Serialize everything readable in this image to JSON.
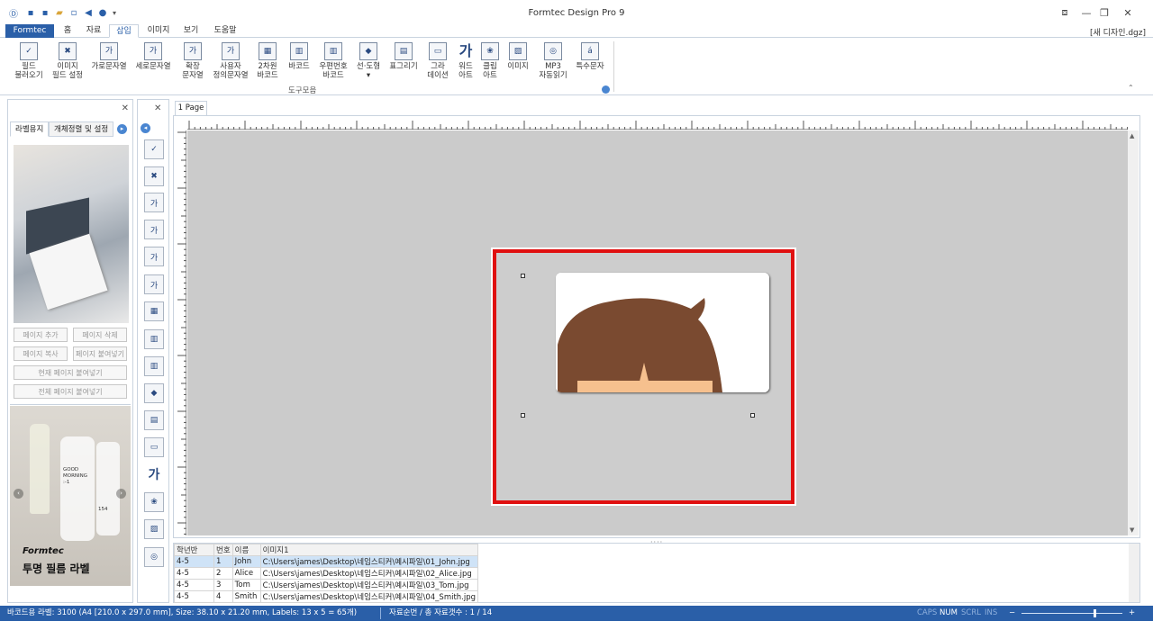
{
  "app": {
    "title": "Formtec Design Pro 9",
    "document": "[새 디자인.dgz]"
  },
  "ribbon_tabs": [
    "Formtec",
    "홈",
    "자료",
    "삽입",
    "이미지",
    "보기",
    "도움말"
  ],
  "ribbon_buttons": [
    {
      "line1": "필드",
      "line2": "불러오기",
      "glyph": "✓"
    },
    {
      "line1": "이미지",
      "line2": "필드 설정",
      "glyph": "✖"
    },
    {
      "line1": "가로문자열",
      "line2": "",
      "glyph": "가"
    },
    {
      "line1": "세로문자열",
      "line2": "",
      "glyph": "가"
    },
    {
      "line1": "확장",
      "line2": "문자열",
      "glyph": "가"
    },
    {
      "line1": "사용자",
      "line2": "정의문자열",
      "glyph": "가"
    },
    {
      "line1": "2차원",
      "line2": "바코드",
      "glyph": "▦"
    },
    {
      "line1": "바코드",
      "line2": "",
      "glyph": "▥"
    },
    {
      "line1": "우편번호",
      "line2": "바코드",
      "glyph": "▥"
    },
    {
      "line1": "선·도형",
      "line2": "▾",
      "glyph": "◆"
    },
    {
      "line1": "표그리기",
      "line2": "",
      "glyph": "▤"
    },
    {
      "line1": "그라",
      "line2": "데이션",
      "glyph": "▭"
    },
    {
      "line1": "워드",
      "line2": "아트",
      "glyph": "가"
    },
    {
      "line1": "클립",
      "line2": "아트",
      "glyph": "❀"
    },
    {
      "line1": "이미지",
      "line2": "",
      "glyph": "▨"
    },
    {
      "line1": "MP3",
      "line2": "자동읽기",
      "glyph": "◎"
    },
    {
      "line1": "특수문자",
      "line2": "",
      "glyph": "á"
    }
  ],
  "ribbon_group": "도구모음",
  "left_panel": {
    "tabs": [
      "라벨용지",
      "개체정렬 및 설정"
    ],
    "buttons": [
      "페이지 추가",
      "페이지 삭제",
      "페이지 복사",
      "페이지 붙여넣기",
      "현재 페이지 붙여넣기",
      "전체 페이지 붙여넣기"
    ],
    "ad_bottle_text": "GOOD MORNING :-1",
    "ad_bottle_number": "154",
    "ad_brand": "Formtec",
    "ad_caption": "투명 필름 라벨"
  },
  "canvas": {
    "page_tab": "1 Page"
  },
  "grid": {
    "headers": [
      "학년반",
      "번호",
      "이름",
      "이미지1"
    ],
    "rows": [
      [
        "4-5",
        "1",
        "John",
        "C:\\Users\\james\\Desktop\\네임스티커\\예시파일\\01_John.jpg"
      ],
      [
        "4-5",
        "2",
        "Alice",
        "C:\\Users\\james\\Desktop\\네임스티커\\예시파일\\02_Alice.jpg"
      ],
      [
        "4-5",
        "3",
        "Tom",
        "C:\\Users\\james\\Desktop\\네임스티커\\예시파일\\03_Tom.jpg"
      ],
      [
        "4-5",
        "4",
        "Smith",
        "C:\\Users\\james\\Desktop\\네임스티커\\예시파일\\04_Smith.jpg"
      ]
    ]
  },
  "status": {
    "label_info": "바코드용 라벨: 3100 (A4 [210.0 x 297.0 mm], Size: 38.10 x 21.20 mm, Labels: 13 x 5 = 65개)",
    "record": "자료순번 / 총 자료갯수 : 1 / 14",
    "caps": "CAPS",
    "num": "NUM",
    "scrl": "SCRL",
    "ins": "INS"
  }
}
